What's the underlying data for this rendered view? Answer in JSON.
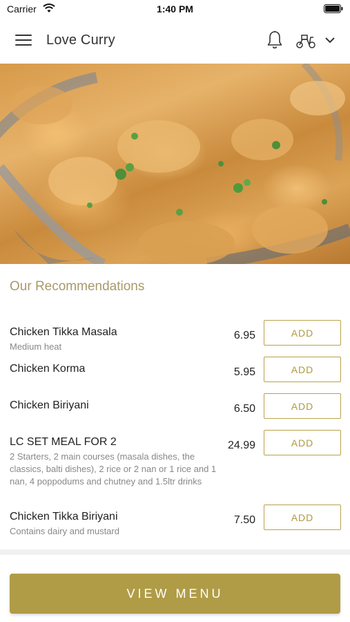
{
  "status_bar": {
    "carrier": "Carrier",
    "time": "1:40 PM"
  },
  "header": {
    "title": "Love Curry",
    "icons": [
      "menu-icon",
      "bell-icon",
      "scooter-icon",
      "chevron-down-icon"
    ]
  },
  "section": {
    "title": "Our Recommendations"
  },
  "items": [
    {
      "name": "Chicken Tikka Masala",
      "desc": "Medium heat",
      "price": "6.95",
      "button": "ADD"
    },
    {
      "name": "Chicken Korma",
      "desc": "",
      "price": "5.95",
      "button": "ADD"
    },
    {
      "name": "Chicken Biriyani",
      "desc": "",
      "price": "6.50",
      "button": "ADD"
    },
    {
      "name": "LC SET MEAL FOR 2",
      "desc": "2 Starters, 2 main courses (masala dishes, the classics, balti dishes), 2 rice or 2 nan or 1 rice and 1 nan, 4 poppodums and chutney and 1.5ltr drinks",
      "price": "24.99",
      "button": "ADD"
    },
    {
      "name": "Chicken Tikka Biriyani",
      "desc": "Contains dairy and mustard",
      "price": "7.50",
      "button": "ADD"
    }
  ],
  "footer": {
    "view_menu_label": "VIEW MENU"
  },
  "colors": {
    "accent": "#b09c47",
    "section_title": "#a89a6a",
    "muted_text": "#888888"
  }
}
